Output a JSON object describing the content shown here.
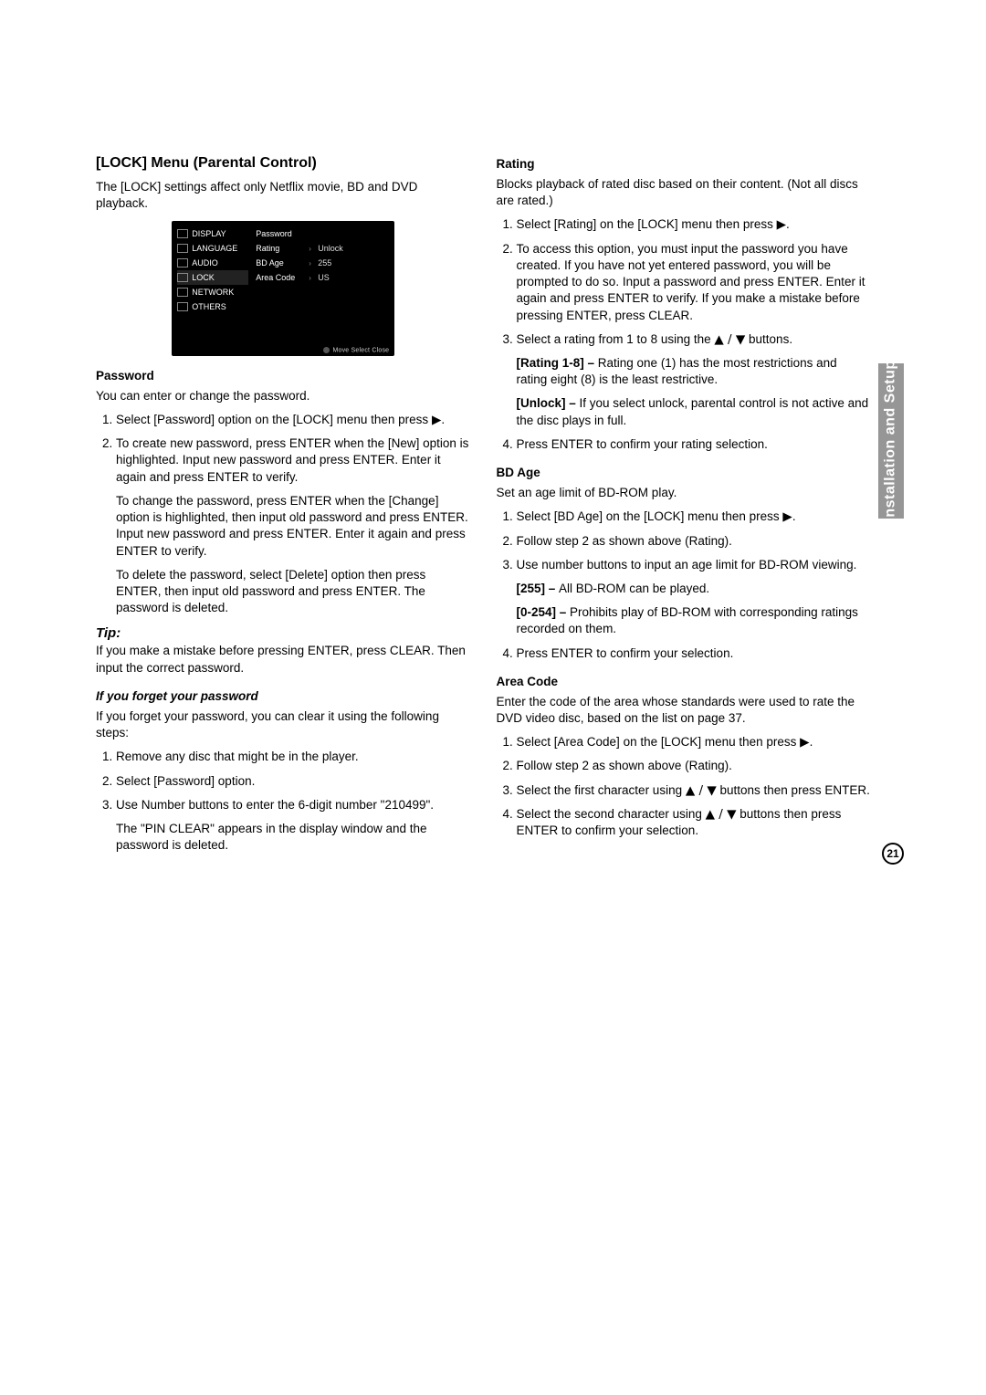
{
  "sideTab": "Installation and Setup",
  "pageNumber": "21",
  "left": {
    "heading": "[LOCK] Menu (Parental Control)",
    "intro": "The [LOCK] settings affect only Netflix movie, BD and DVD playback.",
    "shot": {
      "menu": [
        "DISPLAY",
        "LANGUAGE",
        "AUDIO",
        "LOCK",
        "NETWORK",
        "OTHERS"
      ],
      "rows": [
        {
          "label": "Password",
          "arrow": "",
          "value": ""
        },
        {
          "label": "Rating",
          "arrow": "›",
          "value": "Unlock"
        },
        {
          "label": "BD Age",
          "arrow": "›",
          "value": "255"
        },
        {
          "label": "Area Code",
          "arrow": "›",
          "value": "US"
        }
      ],
      "footer": "Move    Select    Close"
    },
    "passwordHead": "Password",
    "passwordIntro": "You can enter or change the password.",
    "pass_li1a": "Select [Password] option on the [LOCK] menu then press ",
    "pass_li1b": ".",
    "pass_li2": "To create new password, press ENTER when the [New] option is highlighted. Input new password and press ENTER. Enter it again and press ENTER to verify.",
    "pass_li2_p1": "To change the password, press ENTER when the [Change] option is highlighted, then input old password and press ENTER. Input new password and press ENTER. Enter it again and press ENTER to verify.",
    "pass_li2_p2": "To delete the password, select [Delete] option then press ENTER, then input old password and press ENTER. The password is deleted.",
    "tipHead": "Tip:",
    "tipBody": "If you make a mistake before pressing ENTER, press CLEAR. Then input the correct password.",
    "forgotHead": "If you forget your password",
    "forgotIntro": "If you forget your password, you can clear it using the following steps:",
    "forgot_li1": "Remove any disc that might be in the player.",
    "forgot_li2": "Select [Password] option.",
    "forgot_li3": "Use Number buttons to enter the 6-digit number \"210499\".",
    "forgot_li3_p": "The \"PIN CLEAR\" appears in the display window and the password is deleted."
  },
  "right": {
    "ratingHead": "Rating",
    "ratingIntro": "Blocks playback of rated disc based on their content. (Not all discs are rated.)",
    "rating_li1a": "Select [Rating] on the [LOCK] menu then press ",
    "rating_li1b": ".",
    "rating_li2": "To access this option, you must input the password you have created. If you have not yet entered password, you will be prompted to do so. Input a password and press ENTER. Enter it again and press ENTER to verify. If you make a mistake before pressing ENTER, press CLEAR.",
    "rating_li3a": "Select a rating from 1 to 8 using the ",
    "rating_li3b": " buttons.",
    "rating_sub1_label": "[Rating 1-8] – ",
    "rating_sub1_body": "Rating one (1) has the most restrictions and rating eight (8) is the least restrictive.",
    "rating_sub2_label": "[Unlock] – ",
    "rating_sub2_body": "If you select unlock, parental control is not active and the disc plays in full.",
    "rating_li4": "Press ENTER to confirm your rating selection.",
    "bdHead": "BD Age",
    "bdIntro": "Set an age limit of BD-ROM play.",
    "bd_li1a": "Select [BD Age] on the [LOCK] menu then press ",
    "bd_li1b": ".",
    "bd_li2": "Follow step 2 as shown above (Rating).",
    "bd_li3": "Use number buttons to input an age limit for BD-ROM viewing.",
    "bd_sub1_label": "[255] – ",
    "bd_sub1_body": "All BD-ROM can be played.",
    "bd_sub2_label": "[0-254] – ",
    "bd_sub2_body": "Prohibits play of BD-ROM with corresponding ratings recorded on them.",
    "bd_li4": "Press ENTER to confirm your selection.",
    "areaHead": "Area Code",
    "areaIntro": "Enter the code of the area whose standards were used to rate the DVD video disc, based on the list on page 37.",
    "area_li1a": "Select [Area Code] on the [LOCK] menu then press ",
    "area_li1b": ".",
    "area_li2": "Follow step 2 as shown above (Rating).",
    "area_li3a": "Select the first character using ",
    "area_li3b": " buttons then press ENTER.",
    "area_li4a": "Select the second character using ",
    "area_li4b": " buttons then press ENTER to confirm your selection."
  },
  "glyph": {
    "right": "▶",
    "updown": "▲ / ▼"
  }
}
